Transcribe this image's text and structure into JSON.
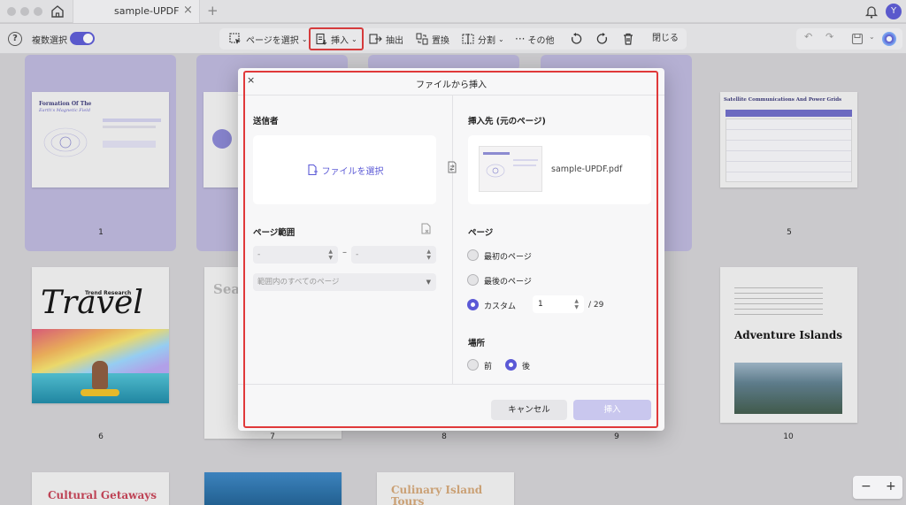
{
  "titlebar": {
    "tab_title": "sample-UPDF",
    "tab_close": "×",
    "new_tab": "+",
    "avatar_letter": "Y"
  },
  "toolbar": {
    "multi_select_label": "複数選択",
    "select_page": "ページを選択",
    "insert": "挿入",
    "extract": "抽出",
    "replace": "置換",
    "split": "分割",
    "more": "その他",
    "close": "閉じる"
  },
  "pages": {
    "p1": {
      "number": "1",
      "title": "Formation Of The",
      "subtitle": "Earth's Magnetic Field"
    },
    "p5": {
      "number": "5",
      "title": "Satellite Communications And Power Grids"
    },
    "p6": {
      "number": "6",
      "trend": "Trend Research",
      "travel": "Travel"
    },
    "p7": {
      "number": "7",
      "title": "Sea"
    },
    "p8": {
      "number": "8"
    },
    "p9": {
      "number": "9"
    },
    "p10": {
      "number": "10",
      "title": "Adventure Islands"
    },
    "bottom1": {
      "title": "Cultural Getaways"
    },
    "bottom3": {
      "title": "Culinary Island Tours"
    }
  },
  "dialog": {
    "close": "×",
    "title": "ファイルから挿入",
    "sender_label": "送信者",
    "choose_file": "ファイルを選択",
    "page_range_label": "ページ範囲",
    "range_from": "-",
    "range_to": "-",
    "range_dash": "–",
    "range_select": "範囲内のすべてのページ",
    "target_label": "挿入先 (元のページ)",
    "target_file": "sample-UPDF.pdf",
    "page_label": "ページ",
    "opt_first": "最初のページ",
    "opt_last": "最後のページ",
    "opt_custom": "カスタム",
    "custom_value": "1",
    "custom_total": "/ 29",
    "location_label": "場所",
    "loc_before": "前",
    "loc_after": "後",
    "cancel": "キャンセル",
    "insert": "挿入",
    "selected_page_option": "custom",
    "selected_location": "after"
  },
  "zoom": {
    "minus": "−",
    "plus": "+"
  },
  "colors": {
    "accent": "#5b59d6",
    "highlight": "#e0393a",
    "selected_card": "#bdb8de"
  }
}
